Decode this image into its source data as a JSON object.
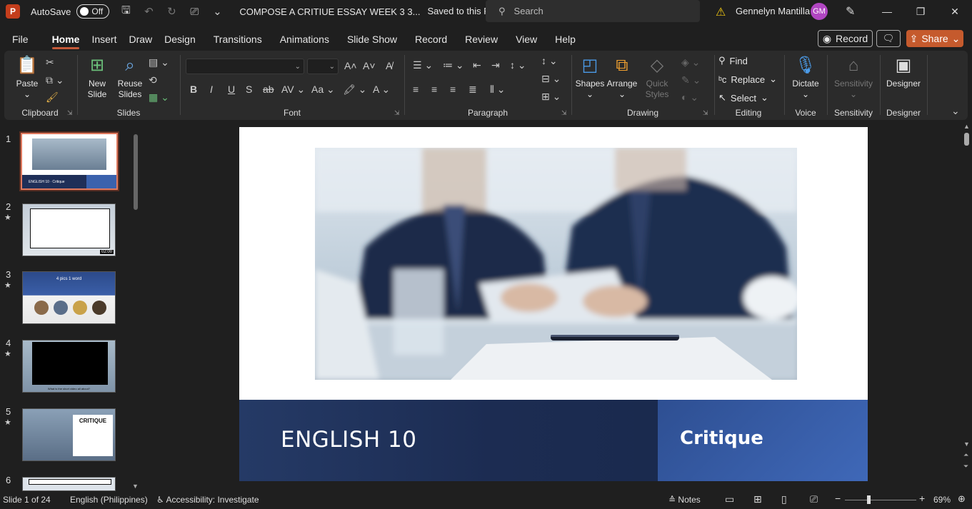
{
  "titlebar": {
    "app_letter": "P",
    "autosave_label": "AutoSave",
    "autosave_state": "Off",
    "doc_title": "COMPOSE A CRITIUE ESSAY WEEK 3 3...",
    "doc_status": "Saved to this PC",
    "search_placeholder": "Search",
    "user_name": "Gennelyn Mantilla",
    "user_initials": "GM"
  },
  "menu": {
    "items": [
      "File",
      "Home",
      "Insert",
      "Draw",
      "Design",
      "Transitions",
      "Animations",
      "Slide Show",
      "Record",
      "Review",
      "View",
      "Help"
    ],
    "active": "Home",
    "record_label": "Record",
    "share_label": "Share"
  },
  "ribbon": {
    "clipboard": {
      "label": "Clipboard",
      "paste": "Paste"
    },
    "slides": {
      "label": "Slides",
      "new_slide": "New Slide",
      "reuse_slides": "Reuse Slides"
    },
    "font": {
      "label": "Font"
    },
    "paragraph": {
      "label": "Paragraph"
    },
    "drawing": {
      "label": "Drawing",
      "shapes": "Shapes",
      "arrange": "Arrange",
      "quick_styles": "Quick Styles"
    },
    "editing": {
      "label": "Editing",
      "find": "Find",
      "replace": "Replace",
      "select": "Select"
    },
    "voice": {
      "label": "Voice",
      "dictate": "Dictate"
    },
    "sensitivity": {
      "label": "Sensitivity",
      "button": "Sensitivity"
    },
    "designer": {
      "label": "Designer",
      "button": "Designer"
    }
  },
  "thumbnails": [
    {
      "num": "1",
      "star": "",
      "text": "ENGLISH 10 · Critique"
    },
    {
      "num": "2",
      "star": "★",
      "text": "02:00"
    },
    {
      "num": "3",
      "star": "★",
      "text": "4 pics 1 word"
    },
    {
      "num": "4",
      "star": "★",
      "text": "What is the short video all about?"
    },
    {
      "num": "5",
      "star": "★",
      "text": "CRITIQUE"
    },
    {
      "num": "6",
      "star": "",
      "text": ""
    }
  ],
  "slide": {
    "title": "ENGLISH 10",
    "subtitle": "Critique"
  },
  "status": {
    "slide_count": "Slide 1 of 24",
    "language": "English (Philippines)",
    "accessibility": "Accessibility: Investigate",
    "notes": "Notes",
    "zoom": "69%"
  },
  "colors": {
    "accent": "#c55a2d",
    "banner_dark": "#1c2c52",
    "banner_light": "#3f68b8"
  }
}
